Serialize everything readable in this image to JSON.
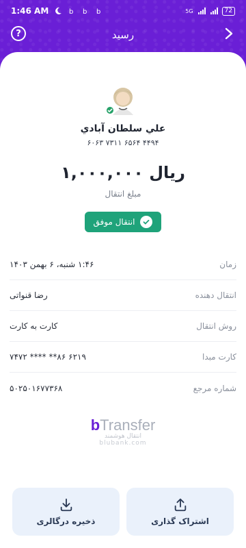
{
  "status_bar": {
    "time": "1:46 AM",
    "network": "5G",
    "battery": "72"
  },
  "header": {
    "title": "رسید"
  },
  "recipient": {
    "name": "علي سلطان آبادي",
    "card_number": "۶۰۶۳ ۷۳۱۱ ۶۵۶۴ ۴۴۹۴"
  },
  "amount": {
    "value": "۱,۰۰۰,۰۰۰ ریال",
    "label": "مبلغ انتقال"
  },
  "status": {
    "label": "انتقال موفق",
    "color": "#1fa37a"
  },
  "details": [
    {
      "label": "زمان",
      "value": "۱:۴۶ شنبه، ۶ بهمن ۱۴۰۳"
    },
    {
      "label": "انتقال دهنده",
      "value": "رضا قنواتی"
    },
    {
      "label": "روش انتقال",
      "value": "کارت به کارت"
    },
    {
      "label": "کارت مبدا",
      "value": "۶۲۱۹ ۸۶** **** ۷۴۷۲"
    },
    {
      "label": "شماره مرجع",
      "value": "۵۰۲۵۰۱۶۷۷۳۶۸"
    }
  ],
  "brand": {
    "logo_b": "b",
    "logo_text": "Transfer",
    "tagline": "انتقال هوشمند",
    "url": "blubank.com"
  },
  "actions": {
    "save_label": "ذخیره درگالری",
    "share_label": "اشتراک گذاری"
  },
  "colors": {
    "accent": "#6a1fd6",
    "success": "#1fa37a",
    "button_bg": "#eaf1fb"
  }
}
